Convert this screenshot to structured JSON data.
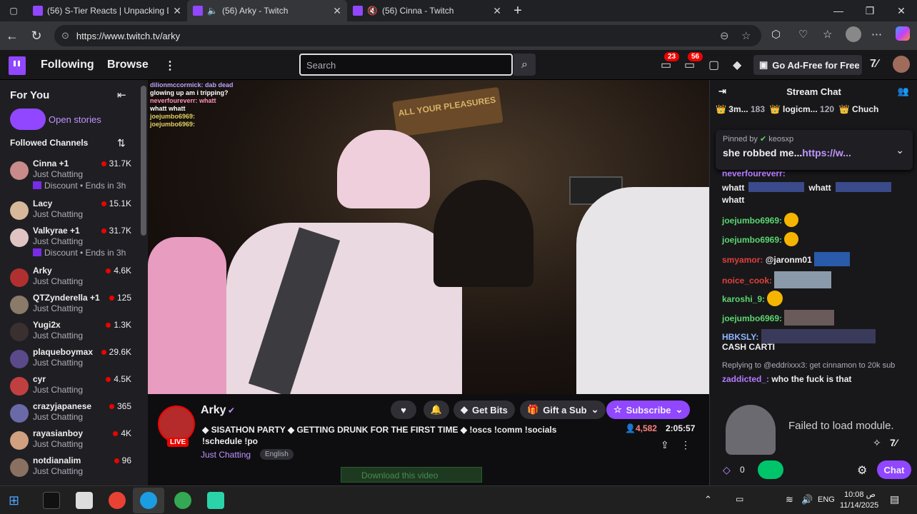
{
  "browser": {
    "tabs": [
      {
        "title": "(56) S-Tier Reacts | Unpacking Dr...",
        "active": false
      },
      {
        "title": "(56) Arky - Twitch",
        "active": true
      },
      {
        "title": "(56) Cinna - Twitch",
        "active": false
      }
    ],
    "url": "https://www.twitch.tv/arky"
  },
  "twitch": {
    "nav": {
      "following": "Following",
      "browse": "Browse",
      "search_placeholder": "Search"
    },
    "notif_badge_1": "23",
    "notif_badge_2": "56",
    "ad_free": "Go Ad-Free for Free"
  },
  "sidebar": {
    "for_you": "For You",
    "open_stories": "Open stories",
    "followed_heading": "Followed Channels",
    "channels": [
      {
        "name": "Cinna +1",
        "game": "Just Chatting",
        "viewers": "31.7K",
        "extra": "Discount • Ends in 3h"
      },
      {
        "name": "Lacy",
        "game": "Just Chatting",
        "viewers": "15.1K",
        "extra": ""
      },
      {
        "name": "Valkyrae +1",
        "game": "Just Chatting",
        "viewers": "31.7K",
        "extra": "Discount • Ends in 3h"
      },
      {
        "name": "Arky",
        "game": "Just Chatting",
        "viewers": "4.6K",
        "extra": ""
      },
      {
        "name": "QTZynderella +1",
        "game": "Just Chatting",
        "viewers": "125",
        "extra": ""
      },
      {
        "name": "Yugi2x",
        "game": "Just Chatting",
        "viewers": "1.3K",
        "extra": ""
      },
      {
        "name": "plaqueboymax",
        "game": "Just Chatting",
        "viewers": "29.6K",
        "extra": ""
      },
      {
        "name": "cyr",
        "game": "Just Chatting",
        "viewers": "4.5K",
        "extra": ""
      },
      {
        "name": "crazyjapanese",
        "game": "Just Chatting",
        "viewers": "365",
        "extra": ""
      },
      {
        "name": "rayasianboy",
        "game": "Just Chatting",
        "viewers": "4K",
        "extra": ""
      },
      {
        "name": "notdianalim",
        "game": "Just Chatting",
        "viewers": "96",
        "extra": ""
      }
    ]
  },
  "video_overlay": {
    "lines": [
      "dilionmccormick: dab dead",
      "glowing up am i tripping?",
      "neverfoureverr: whatt",
      "whatt whatt",
      "joejumbo6969:",
      "joejumbo6969:"
    ],
    "sign": "ALL YOUR PLEASURES"
  },
  "stream": {
    "channel": "Arky",
    "live_label": "LIVE",
    "title": "◆ SISATHON PARTY ◆ GETTING DRUNK FOR THE FIRST TIME ◆ !oscs !comm !socials !schedule !po",
    "category": "Just Chatting",
    "tag": "English",
    "viewers": "4,582",
    "uptime": "2:05:57",
    "get_bits": "Get Bits",
    "gift_sub": "Gift a Sub",
    "subscribe": "Subscribe",
    "download": "Download this video"
  },
  "chat": {
    "header": "Stream Chat",
    "leaderboard": [
      {
        "name": "3m...",
        "count": "183"
      },
      {
        "name": "logicm...",
        "count": "120"
      },
      {
        "name": "Chuch",
        "count": ""
      }
    ],
    "pinned_by": "Pinned by",
    "pinned_user": "keosxp",
    "pinned_text": "she robbed me...",
    "pinned_link": "https://w...",
    "messages": [
      {
        "user": "neverfoureverr:",
        "text": "",
        "color": "#b57aff"
      },
      {
        "user": "",
        "text": "whatt",
        "color": "#efeff1"
      },
      {
        "user": "",
        "text": "whatt",
        "color": "#efeff1"
      },
      {
        "user": "",
        "text": "whatt",
        "color": "#efeff1"
      },
      {
        "user": "joejumbo6969:",
        "text": "",
        "color": "#5ad76e"
      },
      {
        "user": "joejumbo6969:",
        "text": "",
        "color": "#5ad76e"
      },
      {
        "user": "smyamor:",
        "text": "@jaronm01",
        "color": "#e0403a"
      },
      {
        "user": "noice_cook:",
        "text": "",
        "color": "#e0403a"
      },
      {
        "user": "karoshi_9:",
        "text": "",
        "color": "#5ad76e"
      },
      {
        "user": "joejumbo6969:",
        "text": "",
        "color": "#5ad76e"
      },
      {
        "user": "HBKSLY:",
        "text": "",
        "color": "#8fb5ff"
      },
      {
        "user": "",
        "text": "CASH CARTI",
        "color": "#efeff1"
      }
    ],
    "reply_to": "Replying to @eddrixxx3: get cinnamon to 20k sub",
    "reply_user": "zaddicted_:",
    "reply_text": "who the fuck is that",
    "module_error": "Failed to load module.",
    "points": "0",
    "chat_button": "Chat"
  },
  "taskbar": {
    "lang": "ENG",
    "time": "10:08 ص",
    "date": "11/14/2025"
  }
}
